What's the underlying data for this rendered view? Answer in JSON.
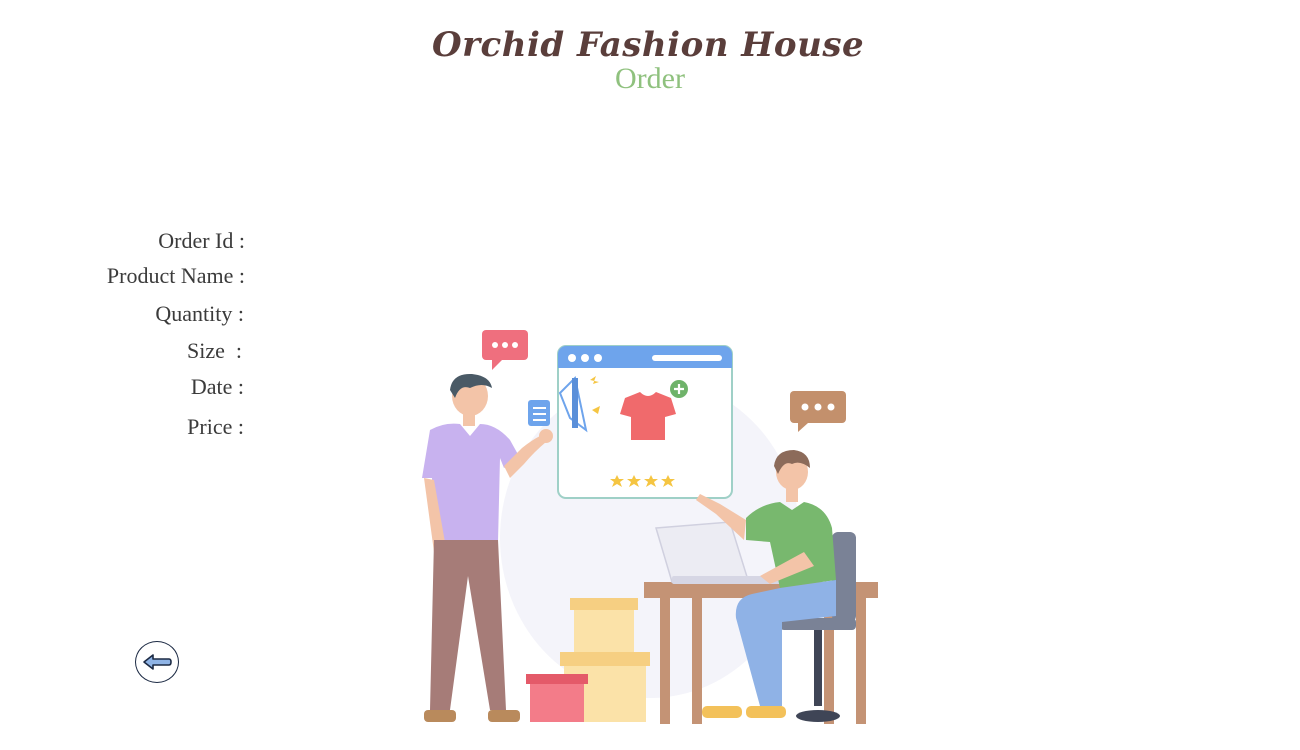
{
  "header": {
    "brand": "Orchid Fashion House",
    "subtitle": "Order"
  },
  "form": {
    "order_id_label": "Order Id :",
    "product_name_label": "Product Name :",
    "quantity_label": "Quantity :",
    "size_label": "Size  :",
    "date_label": "Date :",
    "price_label": "Price :"
  },
  "icons": {
    "brand_logo": "shopping-bags-icon",
    "back": "back-arrow-icon"
  },
  "colors": {
    "brand_title": "#5a3e3b",
    "subtitle": "#8fc17e",
    "label_text": "#3b3b3b",
    "back_button_border": "#1c2a44"
  }
}
